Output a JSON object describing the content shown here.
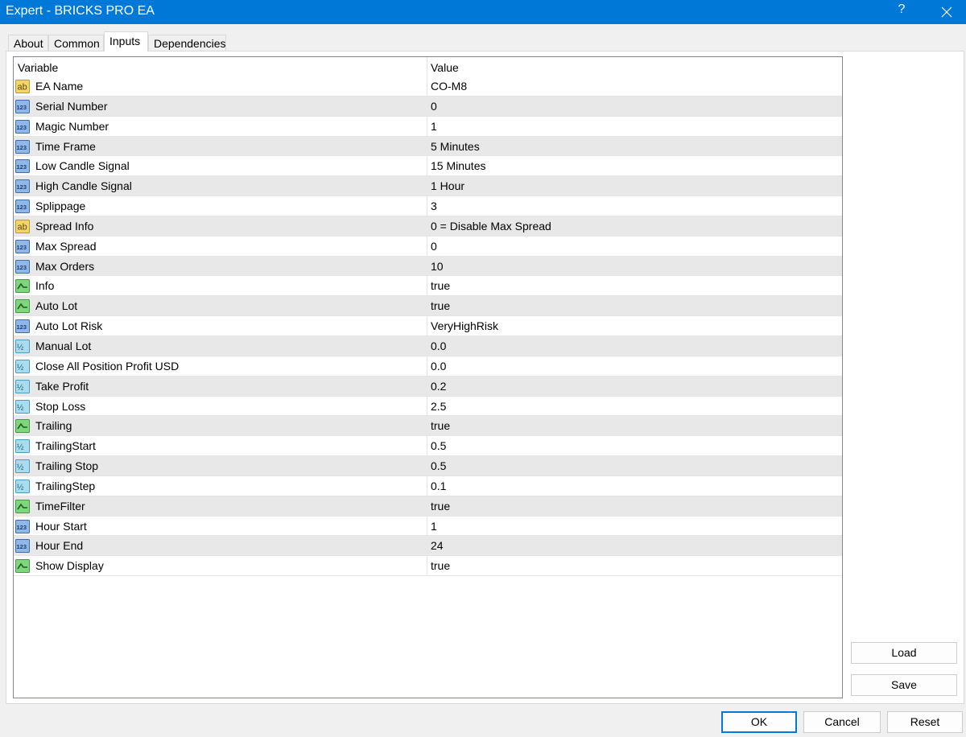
{
  "window": {
    "title": "Expert - BRICKS PRO EA",
    "help_label": "?"
  },
  "tabs": [
    {
      "label": "About"
    },
    {
      "label": "Common"
    },
    {
      "label": "Inputs"
    },
    {
      "label": "Dependencies"
    }
  ],
  "grid": {
    "headers": {
      "variable": "Variable",
      "value": "Value"
    },
    "rows": [
      {
        "icon": "string-icon",
        "name": "EA Name",
        "value": "CO-M8"
      },
      {
        "icon": "integer-icon",
        "name": "Serial Number",
        "value": "0"
      },
      {
        "icon": "integer-icon",
        "name": "Magic Number",
        "value": "1"
      },
      {
        "icon": "integer-icon",
        "name": "Time Frame",
        "value": "5 Minutes"
      },
      {
        "icon": "integer-icon",
        "name": "Low Candle Signal",
        "value": "15 Minutes"
      },
      {
        "icon": "integer-icon",
        "name": "High Candle Signal",
        "value": "1 Hour"
      },
      {
        "icon": "integer-icon",
        "name": "Splippage",
        "value": "3"
      },
      {
        "icon": "string-icon",
        "name": "Spread Info",
        "value": "0 = Disable Max Spread"
      },
      {
        "icon": "integer-icon",
        "name": "Max Spread",
        "value": "0"
      },
      {
        "icon": "integer-icon",
        "name": "Max Orders",
        "value": "10"
      },
      {
        "icon": "boolean-icon",
        "name": "Info",
        "value": "true"
      },
      {
        "icon": "boolean-icon",
        "name": "Auto Lot",
        "value": "true"
      },
      {
        "icon": "integer-icon",
        "name": "Auto Lot Risk",
        "value": "VeryHighRisk"
      },
      {
        "icon": "double-icon",
        "name": "Manual Lot",
        "value": "0.0"
      },
      {
        "icon": "double-icon",
        "name": "Close All Position Profit USD",
        "value": "0.0"
      },
      {
        "icon": "double-icon",
        "name": "Take Profit",
        "value": "0.2"
      },
      {
        "icon": "double-icon",
        "name": "Stop Loss",
        "value": "2.5"
      },
      {
        "icon": "boolean-icon",
        "name": "Trailing",
        "value": "true"
      },
      {
        "icon": "double-icon",
        "name": "TrailingStart",
        "value": "0.5"
      },
      {
        "icon": "double-icon",
        "name": "Trailing Stop",
        "value": "0.5"
      },
      {
        "icon": "double-icon",
        "name": "TrailingStep",
        "value": "0.1"
      },
      {
        "icon": "boolean-icon",
        "name": "TimeFilter",
        "value": "true"
      },
      {
        "icon": "integer-icon",
        "name": "Hour Start",
        "value": "1"
      },
      {
        "icon": "integer-icon",
        "name": "Hour End",
        "value": "24"
      },
      {
        "icon": "boolean-icon",
        "name": "Show Display",
        "value": "true"
      }
    ]
  },
  "side_buttons": {
    "load": "Load",
    "save": "Save"
  },
  "footer": {
    "ok": "OK",
    "cancel": "Cancel",
    "reset": "Reset"
  }
}
